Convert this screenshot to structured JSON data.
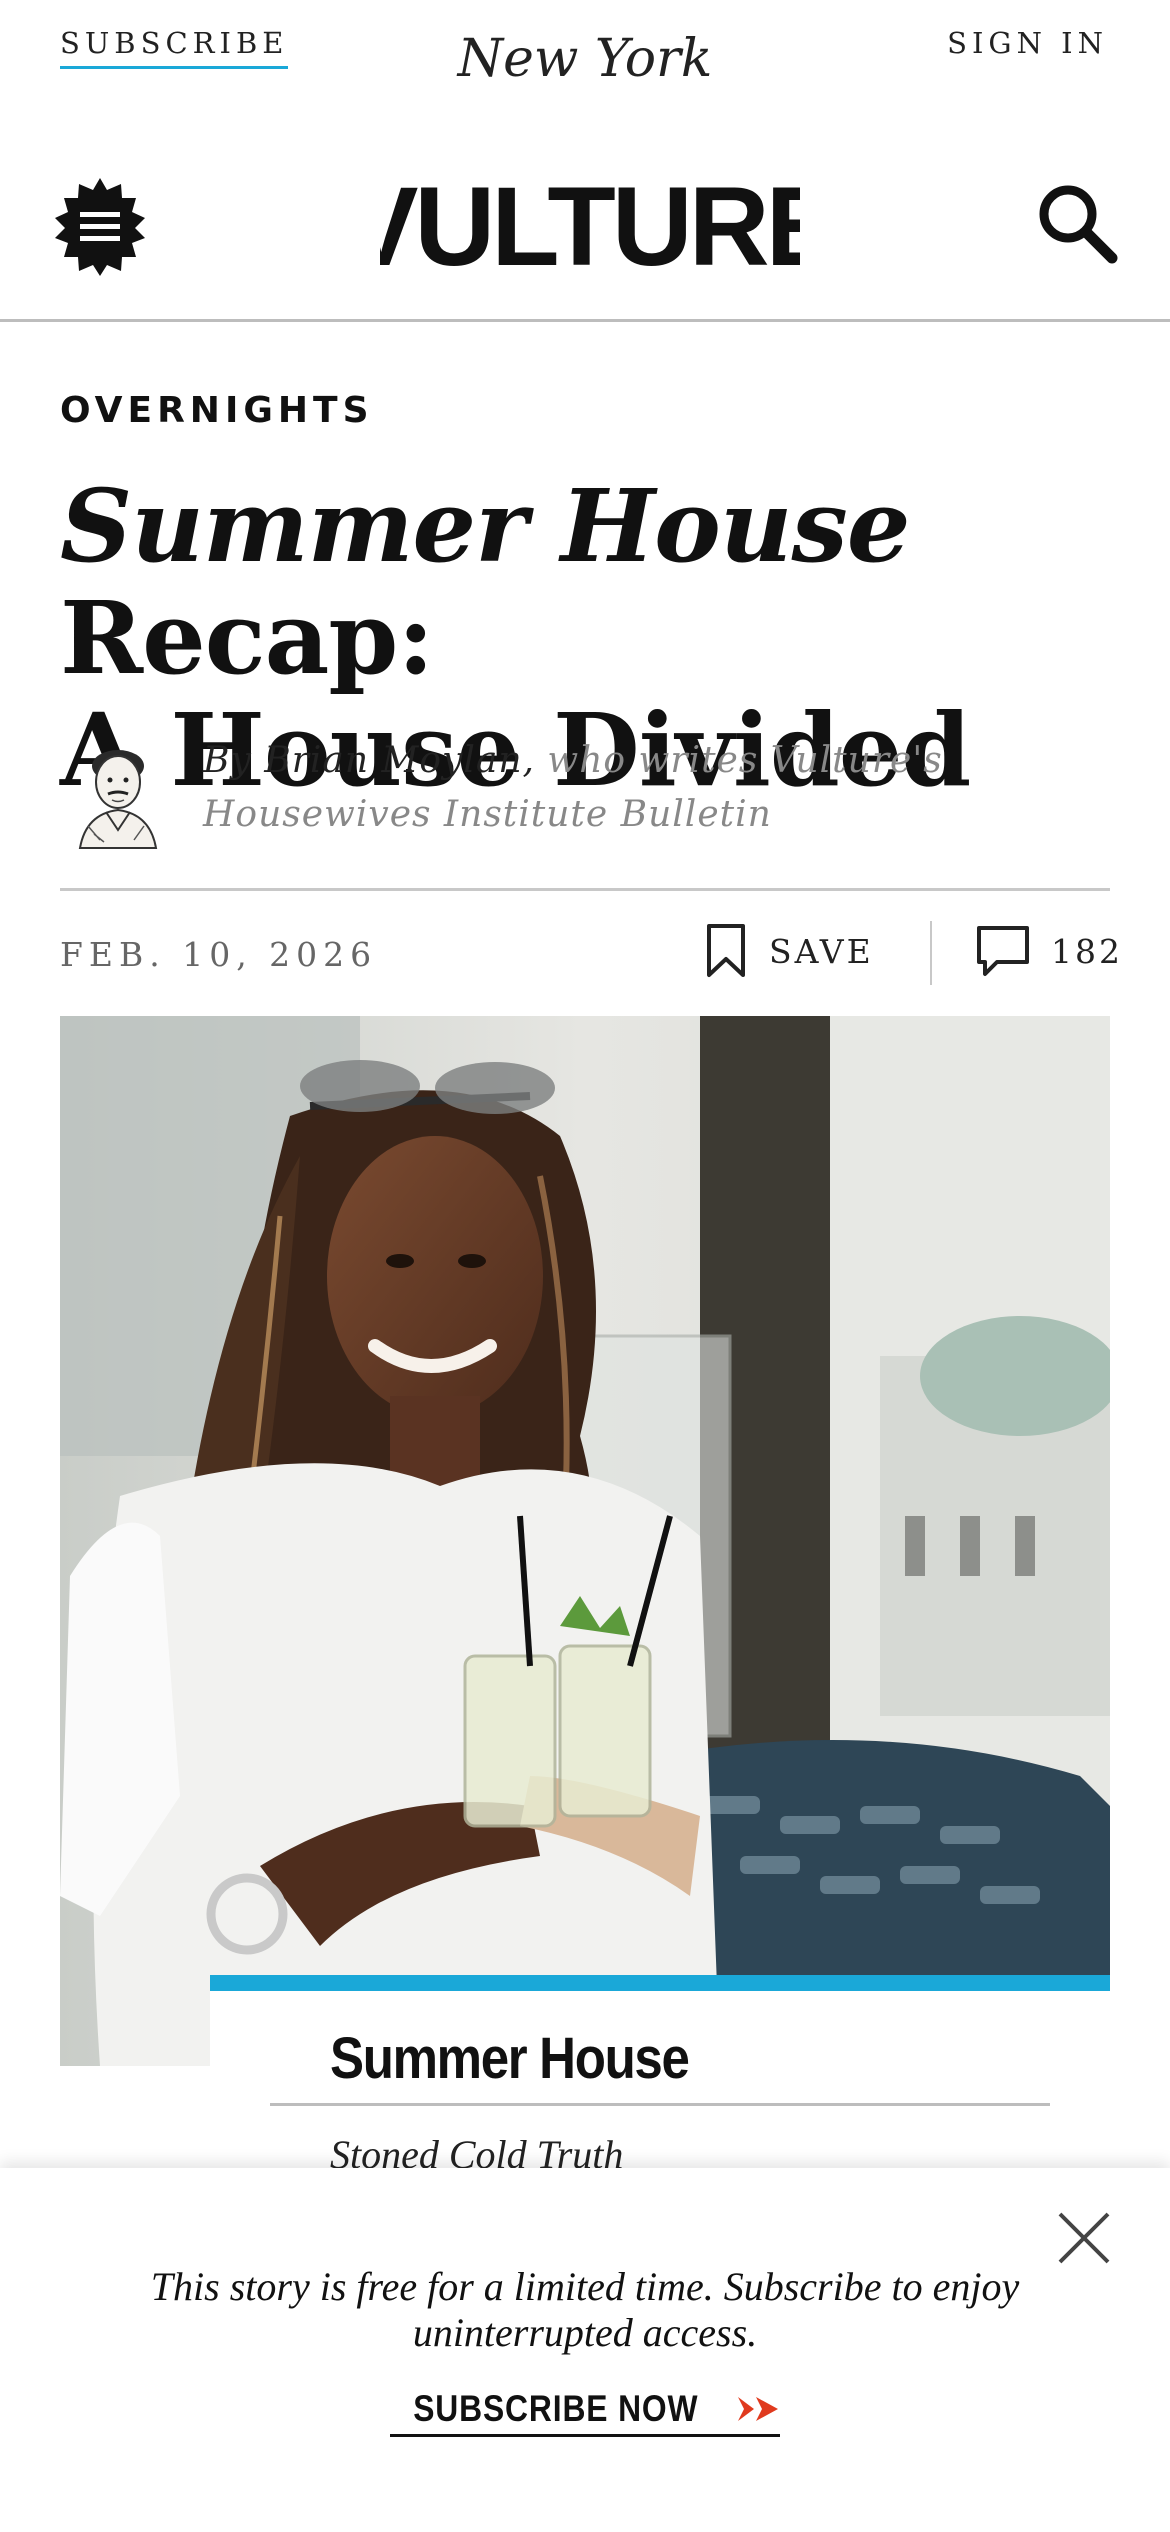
{
  "topbar": {
    "subscribe_label": "SUBSCRIBE",
    "brand_logo_text": "New York",
    "signin_label": "SIGN IN"
  },
  "masthead": {
    "logo_text": "VULTURE",
    "menu_icon": "hamburger-menu-icon",
    "search_icon": "search-icon"
  },
  "article": {
    "rubric": "OVERNIGHTS",
    "headline_italic": "Summer House",
    "headline_rest_line1": " Recap:",
    "headline_line2": "A House Divided",
    "byline_name": "By Brian Moylan,",
    "byline_desc_1": " who writes Vulture's",
    "byline_desc_2": "Housewives Institute Bulletin",
    "date": "FEB. 10, 2026",
    "save_label": "SAVE",
    "comment_count": "182"
  },
  "show_card": {
    "show_title": "Summer House",
    "episode_title": "Stoned Cold Truth"
  },
  "paywall": {
    "message": "This story is free for a limited time. Subscribe to enjoy uninterrupted access.",
    "cta_label": "SUBSCRIBE NOW",
    "close_icon": "close-icon"
  },
  "colors": {
    "accent_blue": "#1aa8d8",
    "cta_arrow_red": "#e03a1e",
    "text_dark": "#111111",
    "text_muted": "#888888"
  }
}
